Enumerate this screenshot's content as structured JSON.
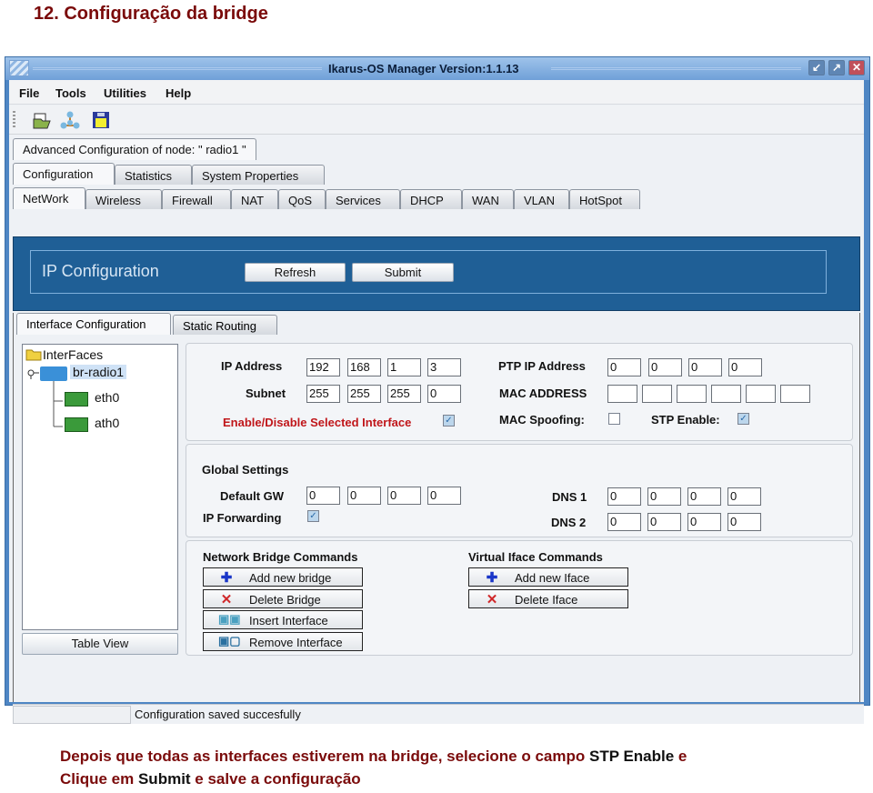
{
  "heading": "12.  Configuração da bridge",
  "window": {
    "title": "Ikarus-OS Manager  Version:1.1.13",
    "controls": {
      "minimize": "↙",
      "maximize": "↗",
      "close": "✕"
    }
  },
  "menu": [
    "File",
    "Tools",
    "Utilities",
    "Help"
  ],
  "toolbar": {
    "icons": [
      "open-folder-icon",
      "network-topology-icon",
      "save-disk-icon"
    ]
  },
  "tabs": {
    "node": "Advanced Configuration of node:  \" radio1 \"",
    "level1": [
      "Configuration",
      "Statistics",
      "System Properties"
    ],
    "level2": [
      "NetWork",
      "Wireless",
      "Firewall",
      "NAT",
      "QoS",
      "Services",
      "DHCP",
      "WAN",
      "VLAN",
      "HotSpot"
    ]
  },
  "ip_panel": {
    "title": "IP Configuration",
    "refresh": "Refresh",
    "submit": "Submit"
  },
  "subtabs": [
    "Interface Configuration",
    "Static Routing"
  ],
  "tree": {
    "root": "InterFaces",
    "bridge": "br-radio1",
    "children": [
      "eth0",
      "ath0"
    ],
    "table_view": "Table View"
  },
  "interface": {
    "ip_label": "IP Address",
    "ip": [
      "192",
      "168",
      "1",
      "3"
    ],
    "subnet_label": "Subnet",
    "subnet": [
      "255",
      "255",
      "255",
      "0"
    ],
    "enable_label": "Enable/Disable Selected Interface",
    "enable_checked": true,
    "ptp_label": "PTP IP Address",
    "ptp": [
      "0",
      "0",
      "0",
      "0"
    ],
    "mac_label": "MAC ADDRESS",
    "mac": [
      "",
      "",
      "",
      "",
      "",
      ""
    ],
    "mac_spoof_label": "MAC Spoofing:",
    "mac_spoof_checked": false,
    "stp_label": "STP Enable:",
    "stp_checked": true
  },
  "global": {
    "title": "Global Settings",
    "gw_label": "Default GW",
    "gw": [
      "0",
      "0",
      "0",
      "0"
    ],
    "ipfwd_label": "IP Forwarding",
    "ipfwd_checked": true,
    "dns1_label": "DNS 1",
    "dns1": [
      "0",
      "0",
      "0",
      "0"
    ],
    "dns2_label": "DNS 2",
    "dns2": [
      "0",
      "0",
      "0",
      "0"
    ]
  },
  "bridge_cmds": {
    "title": "Network Bridge Commands",
    "buttons": [
      "Add new bridge",
      "Delete Bridge",
      "Insert Interface",
      "Remove Interface"
    ]
  },
  "iface_cmds": {
    "title": "Virtual Iface Commands",
    "buttons": [
      "Add new Iface",
      "Delete Iface"
    ]
  },
  "status": "Configuration saved succesfully",
  "caption": {
    "line1_a": "Depois que todas as interfaces estiverem na bridge, selecione o campo ",
    "line1_b": "STP Enable",
    "line1_c": " e",
    "line2_a": "Clique em ",
    "line2_b": "Submit",
    "line2_c": " e salve a configuração"
  },
  "colors": {
    "heading": "#7a0a0a",
    "panel_blue": "#1f5f96",
    "enable_red": "#c0161a"
  }
}
